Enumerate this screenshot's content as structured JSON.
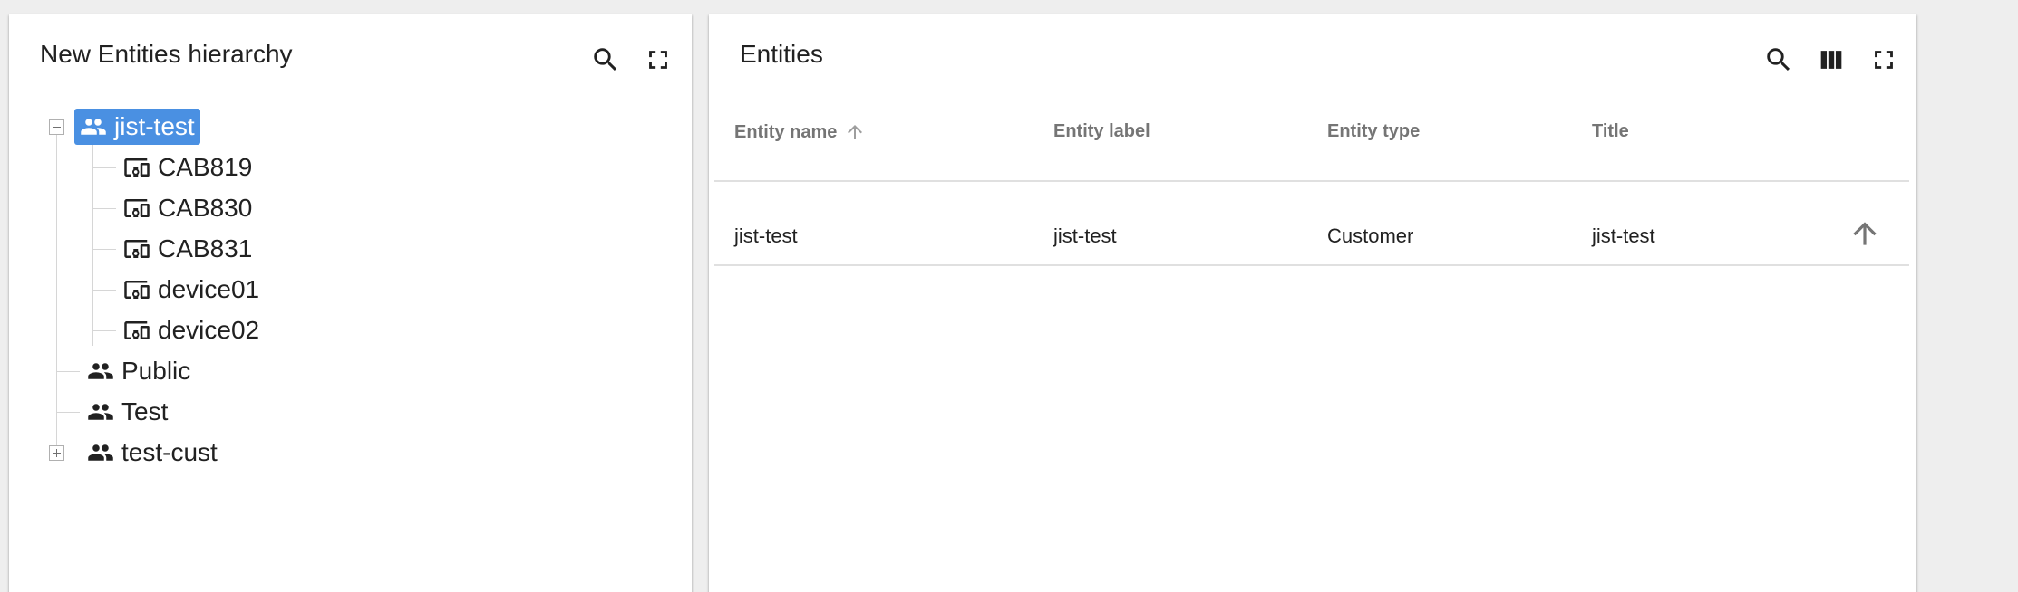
{
  "hierarchy_widget": {
    "title": "New Entities hierarchy",
    "tree": {
      "root_expanded": {
        "label": "jist-test",
        "icon": "customer-icon",
        "selected": true,
        "children": [
          {
            "label": "CAB819",
            "icon": "devices-icon"
          },
          {
            "label": "CAB830",
            "icon": "devices-icon"
          },
          {
            "label": "CAB831",
            "icon": "devices-icon"
          },
          {
            "label": "device01",
            "icon": "devices-icon"
          },
          {
            "label": "device02",
            "icon": "devices-icon"
          }
        ]
      },
      "siblings": [
        {
          "label": "Public",
          "icon": "customer-icon"
        },
        {
          "label": "Test",
          "icon": "customer-icon"
        },
        {
          "label": "test-cust",
          "icon": "customer-icon",
          "collapsed": true
        }
      ]
    },
    "icons": [
      "search-icon",
      "fullscreen-icon"
    ]
  },
  "entities_widget": {
    "title": "Entities",
    "icons": [
      "search-icon",
      "columns-icon",
      "fullscreen-icon"
    ],
    "columns": [
      "Entity name",
      "Entity label",
      "Entity type",
      "Title"
    ],
    "sort": {
      "column": "Entity name",
      "direction": "ascending"
    },
    "rows": [
      {
        "entity_name": "jist-test",
        "entity_label": "jist-test",
        "entity_type": "Customer",
        "title": "jist-test",
        "action_icon": "arrow-up-icon"
      }
    ]
  },
  "colors": {
    "selected_node": "#4a90e2",
    "page_background": "#eeeeee",
    "header_text": "#757575"
  }
}
